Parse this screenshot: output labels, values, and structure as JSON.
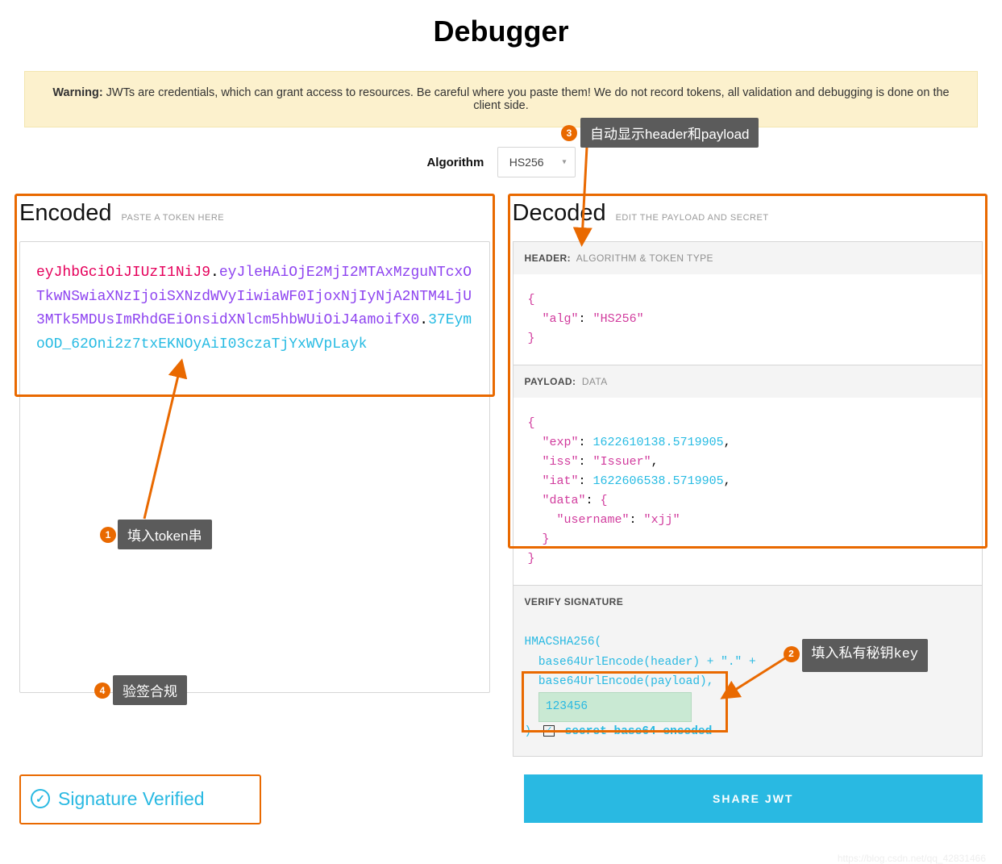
{
  "title": "Debugger",
  "warning": {
    "label": "Warning:",
    "text": " JWTs are credentials, which can grant access to resources. Be careful where you paste them! We do not record tokens, all validation and debugging is done on the client side."
  },
  "algorithm": {
    "label": "Algorithm",
    "selected": "HS256"
  },
  "encoded": {
    "title": "Encoded",
    "hint": "PASTE A TOKEN HERE",
    "header_part": "eyJhbGciOiJIUzI1NiJ9",
    "payload_part": "eyJleHAiOjE2MjI2MTAxMzguNTcxOTkwNSwiaXNzIjoiSXNzdWVyIiwiaWF0IjoxNjIyNjA2NTM4LjU3MTk5MDUsImRhdGEiOnsidXNlcm5hbWUiOiJ4amoifX0",
    "sig_part": "37EymoOD_62Oni2z7txEKNOyAiI03czaTjYxWVpLayk"
  },
  "decoded": {
    "title": "Decoded",
    "hint": "EDIT THE PAYLOAD AND SECRET",
    "header_label": "HEADER:",
    "header_sub": "ALGORITHM & TOKEN TYPE",
    "header_json_alg": "HS256",
    "payload_label": "PAYLOAD:",
    "payload_sub": "DATA",
    "payload": {
      "exp": "1622610138.5719905",
      "iss": "Issuer",
      "iat": "1622606538.5719905",
      "data_username": "xjj"
    },
    "verify_label": "VERIFY SIGNATURE",
    "verify_fn": "HMACSHA256(",
    "verify_l1": "  base64UrlEncode(header) + \".\" +",
    "verify_l2": "  base64UrlEncode(payload),",
    "secret_value": "123456",
    "verify_close": ") ",
    "secret_b64_label": "secret base64 encoded",
    "secret_b64_checked": true
  },
  "signature_status": "Signature Verified",
  "share_label": "SHARE JWT",
  "annotations": {
    "a1": "填入token串",
    "a2": "填入私有秘钥key",
    "a3": "自动显示header和payload",
    "a4": "验签合规"
  },
  "watermark": "https://blog.csdn.net/qq_42831466"
}
